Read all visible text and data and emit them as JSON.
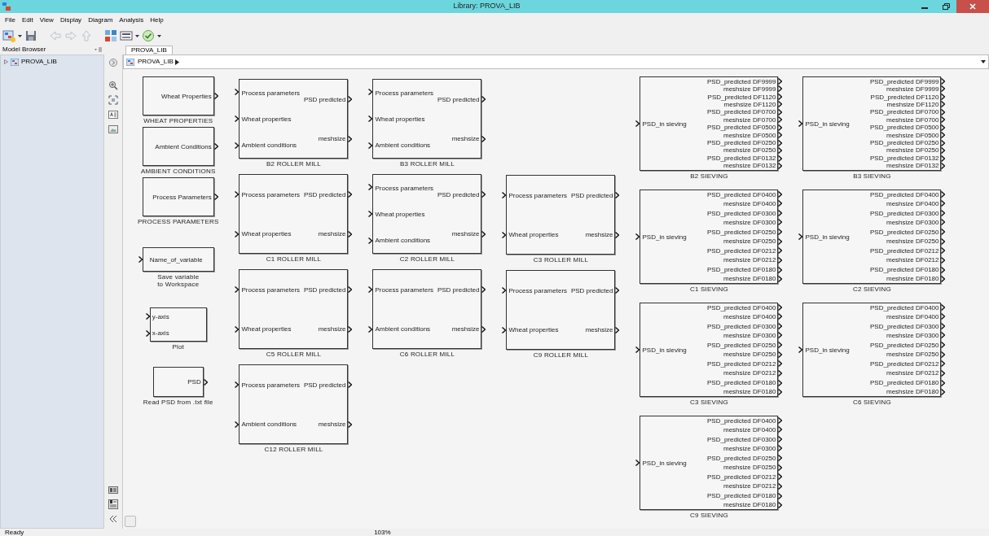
{
  "window": {
    "title": "Library: PROVA_LIB"
  },
  "menus": [
    "File",
    "Edit",
    "View",
    "Display",
    "Diagram",
    "Analysis",
    "Help"
  ],
  "model_browser": {
    "title": "Model Browser",
    "tree": [
      {
        "label": "PROVA_LIB",
        "expanded": false
      }
    ]
  },
  "tabs": [
    {
      "label": "PROVA_LIB",
      "selected": true
    }
  ],
  "address": [
    {
      "label": "PROVA_LIB"
    }
  ],
  "canvas": {
    "columns": [
      {
        "blocks": [
          {
            "kind": "source",
            "outputs": [
              "Wheat Properties"
            ],
            "label": [
              "WHEAT PROPERTIES"
            ]
          },
          {
            "kind": "source",
            "outputs": [
              "Ambient Conditions"
            ],
            "label": [
              "AMBIENT CONDITIONS"
            ]
          },
          {
            "kind": "source",
            "outputs": [
              "Process Parameters"
            ],
            "label": [
              "PROCESS PARAMETERS"
            ]
          },
          {
            "kind": "sink",
            "inputs": [
              "Name_of_variable"
            ],
            "label": [
              "Save variable",
              "to Workspace"
            ]
          },
          {
            "kind": "plot",
            "inputs": [
              "y-axis",
              "x-axis"
            ],
            "label": [
              "Plot"
            ]
          },
          {
            "kind": "reader",
            "outputs": [
              "PSD"
            ],
            "label": [
              "Read PSD from .txt file"
            ]
          }
        ]
      },
      {
        "blocks": [
          {
            "kind": "mill",
            "inputs": [
              "Process parameters",
              "Wheat properties",
              "Ambient conditions"
            ],
            "outputs": [
              "PSD predicted",
              "meshsize"
            ],
            "label": [
              "B2 ROLLER MILL"
            ]
          },
          {
            "kind": "mill",
            "inputs": [
              "Process parameters",
              "Wheat properties"
            ],
            "outputs": [
              "PSD predicted",
              "meshsize"
            ],
            "label": [
              "C1 ROLLER MILL"
            ]
          },
          {
            "kind": "mill",
            "inputs": [
              "Process parameters",
              "Wheat properties"
            ],
            "outputs": [
              "PSD predicted",
              "meshsize"
            ],
            "label": [
              "C5 ROLLER MILL"
            ]
          },
          {
            "kind": "mill",
            "inputs": [
              "Process parameters",
              "Ambient conditions"
            ],
            "outputs": [
              "PSD predicted",
              "meshsize"
            ],
            "label": [
              "C12 ROLLER MILL"
            ]
          }
        ]
      },
      {
        "blocks": [
          {
            "kind": "mill",
            "inputs": [
              "Process parameters",
              "Wheat properties",
              "Ambient conditions"
            ],
            "outputs": [
              "PSD predicted",
              "meshsize"
            ],
            "label": [
              "B3 ROLLER MILL"
            ]
          },
          {
            "kind": "mill",
            "inputs": [
              "Process parameters",
              "Wheat properties",
              "Ambient conditions"
            ],
            "outputs": [
              "PSD predicted",
              "meshsize"
            ],
            "label": [
              "C2 ROLLER MILL"
            ]
          },
          {
            "kind": "mill",
            "inputs": [
              "Process parameters",
              "Ambient conditions"
            ],
            "outputs": [
              "PSD predicted",
              "meshsize"
            ],
            "label": [
              "C6 ROLLER MILL"
            ]
          }
        ]
      },
      {
        "blocks": [
          {
            "kind": "mill",
            "inputs": [
              "Process parameters",
              "Wheat properties"
            ],
            "outputs": [
              "PSD predicted",
              "meshsize"
            ],
            "label": [
              "C3 ROLLER MILL"
            ]
          },
          {
            "kind": "mill",
            "inputs": [
              "Process parameters",
              "Wheat properties"
            ],
            "outputs": [
              "PSD predicted",
              "meshsize"
            ],
            "label": [
              "C9 ROLLER MILL"
            ]
          }
        ]
      },
      {
        "blocks": [
          {
            "kind": "sieve",
            "inputs": [
              "PSD_in sieving"
            ],
            "outputs": [
              "PSD_predicted DF9999",
              "meshsize DF9999",
              "PSD_predicted DF1120",
              "meshsize DF1120",
              "PSD_predicted DF0700",
              "meshsize DF0700",
              "PSD_predicted DF0500",
              "meshsize DF0500",
              "PSD_predicted DF0250",
              "meshsize DF0250",
              "PSD_predicted DF0132",
              "meshsize DF0132"
            ],
            "label": [
              "B2 SIEVING"
            ]
          },
          {
            "kind": "sieve",
            "inputs": [
              "PSD_in sieving"
            ],
            "outputs": [
              "PSD_predicted DF0400",
              "meshsize DF0400",
              "PSD_predicted DF0300",
              "meshsize DF0300",
              "PSD_predicted DF0250",
              "meshsize DF0250",
              "PSD_predicted DF0212",
              "meshsize DF0212",
              "PSD_predicted DF0180",
              "meshsize DF0180"
            ],
            "label": [
              "C1 SIEVING"
            ]
          },
          {
            "kind": "sieve",
            "inputs": [
              "PSD_in sieving"
            ],
            "outputs": [
              "PSD_predicted DF0400",
              "meshsize DF0400",
              "PSD_predicted DF0300",
              "meshsize DF0300",
              "PSD_predicted DF0250",
              "meshsize DF0250",
              "PSD_predicted DF0212",
              "meshsize DF0212",
              "PSD_predicted DF0180",
              "meshsize DF0180"
            ],
            "label": [
              "C3 SIEVING"
            ]
          },
          {
            "kind": "sieve",
            "inputs": [
              "PSD_in sieving"
            ],
            "outputs": [
              "PSD_predicted DF0400",
              "meshsize DF0400",
              "PSD_predicted DF0300",
              "meshsize DF0300",
              "PSD_predicted DF0250",
              "meshsize DF0250",
              "PSD_predicted DF0212",
              "meshsize DF0212",
              "PSD_predicted DF0180",
              "meshsize DF0180"
            ],
            "label": [
              "C9 SIEVING"
            ]
          }
        ]
      },
      {
        "blocks": [
          {
            "kind": "sieve",
            "inputs": [
              "PSD_in sieving"
            ],
            "outputs": [
              "PSD_predicted DF9999",
              "meshsize DF9999",
              "PSD_predicted DF1120",
              "meshsize DF1120",
              "PSD_predicted DF0700",
              "meshsize DF0700",
              "PSD_predicted DF0500",
              "meshsize DF0500",
              "PSD_predicted DF0250",
              "meshsize DF0250",
              "PSD_predicted DF0132",
              "meshsize DF0132"
            ],
            "label": [
              "B3 SIEVING"
            ]
          },
          {
            "kind": "sieve",
            "inputs": [
              "PSD_in sieving"
            ],
            "outputs": [
              "PSD_predicted DF0400",
              "meshsize DF0400",
              "PSD_predicted DF0300",
              "meshsize DF0300",
              "PSD_predicted DF0250",
              "meshsize DF0250",
              "PSD_predicted DF0212",
              "meshsize DF0212",
              "PSD_predicted DF0180",
              "meshsize DF0180"
            ],
            "label": [
              "C2 SIEVING"
            ]
          },
          {
            "kind": "sieve",
            "inputs": [
              "PSD_in sieving"
            ],
            "outputs": [
              "PSD_predicted DF0400",
              "meshsize DF0400",
              "PSD_predicted DF0300",
              "meshsize DF0300",
              "PSD_predicted DF0250",
              "meshsize DF0250",
              "PSD_predicted DF0212",
              "meshsize DF0212",
              "PSD_predicted DF0180",
              "meshsize DF0180"
            ],
            "label": [
              "C6 SIEVING"
            ]
          }
        ]
      }
    ]
  },
  "status_bar": {
    "left": "Ready",
    "zoom": "103%"
  }
}
